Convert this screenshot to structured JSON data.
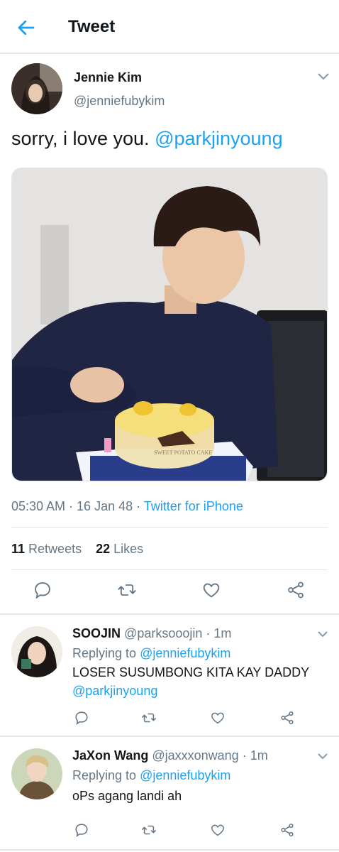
{
  "header": {
    "title": "Tweet",
    "back_icon": "arrow-left-icon"
  },
  "colors": {
    "accent": "#1da1f2",
    "secondary_text": "#657786",
    "divider": "#e1e8ed"
  },
  "tweet": {
    "author_name": "Jennie Kim",
    "author_handle": "@jenniefubykim",
    "text": "sorry, i love you. ",
    "mention": "@parkjinyoung",
    "photo_caption": "SWEET POTATO CAKE",
    "time": "05:30 AM · 16 Jan 48 · ",
    "client": "Twitter for iPhone",
    "retweets_count": "11",
    "retweets_label": "Retweets",
    "likes_count": "22",
    "likes_label": "Likes"
  },
  "replies": [
    {
      "name": "SOOJIN",
      "handle_time": "@parksooojin · 1m",
      "replying_prefix": "Replying to ",
      "replying_to": "@jenniefubykim",
      "text": "LOSER SUSUMBONG KITA KAY DADDY",
      "mention": "@parkjinyoung"
    },
    {
      "name": "JaXon Wang",
      "handle_time": "@jaxxxonwang · 1m",
      "replying_prefix": "Replying to ",
      "replying_to": "@jenniefubykim",
      "text": "oPs agang landi ah"
    }
  ]
}
